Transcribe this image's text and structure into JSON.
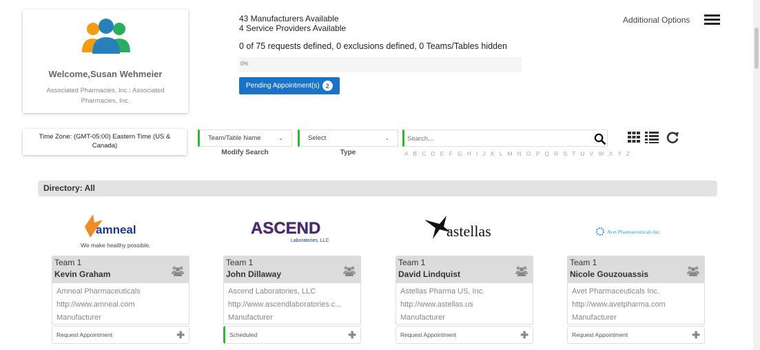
{
  "profile": {
    "welcome": "Welcome,Susan Wehmeier",
    "organization": "Associated Pharmacies, Inc.: Associated Pharmacies, Inc."
  },
  "summary": {
    "manufacturers": "43 Manufacturers Available",
    "providers": "4 Service Providers Available",
    "requests": "0 of 75 requests defined, 0 exclusions defined, 0 Teams/Tables hidden",
    "progress_label": "0%",
    "progress_value": 0
  },
  "pending": {
    "label": "Pending Appointment(s)",
    "count": "2"
  },
  "header": {
    "additional_options": "Additional Options"
  },
  "filters": {
    "timezone": "Time Zone: (GMT-05:00) Eastern Time (US & Canada)",
    "search_by": {
      "value": "Team/Table Name",
      "caption": "Modify Search"
    },
    "type": {
      "value": "Select",
      "caption": "Type"
    },
    "search_placeholder": "Search...",
    "alphabet": "A B C D E F G H I J K L M N O P Q R S T U V W X Y Z"
  },
  "directory": {
    "title": "Directory: All"
  },
  "logos": {
    "amneal": {
      "name": "amneal",
      "tagline": "We make healthy possible."
    },
    "ascend": {
      "name": "ASCEND",
      "sub": "Laboratories, LLC"
    },
    "astellas": {
      "name": "astellas"
    },
    "avet": {
      "name": "Avet Pharmaceuticals Inc."
    }
  },
  "cards": [
    {
      "team": "Team 1",
      "person": "Kevin Graham",
      "company": "Amneal Pharmaceuticals",
      "url": "http://www.amneal.com",
      "kind": "Manufacturer",
      "action": "Request Appointment"
    },
    {
      "team": "Team 1",
      "person": "John Dillaway",
      "company": "Ascend Laboratories, LLC",
      "url": "http://www.ascendlaboratories.c...",
      "kind": "Manufacturer",
      "action": "Scheduled"
    },
    {
      "team": "Team 1",
      "person": "David Lindquist",
      "company": "Astellas Pharma US, Inc.",
      "url": "http://www.astellas.us",
      "kind": "Manufacturer",
      "action": "Request Appointment"
    },
    {
      "team": "Team 1",
      "person": "Nicole Gouzouassis",
      "company": "Avet Pharmaceuticals Inc.",
      "url": "http://www.avetpharma.com",
      "kind": "Manufacturer",
      "action": "Request Appointment"
    }
  ],
  "colors": {
    "accent": "#1a73c6",
    "green": "#2eb82e"
  }
}
